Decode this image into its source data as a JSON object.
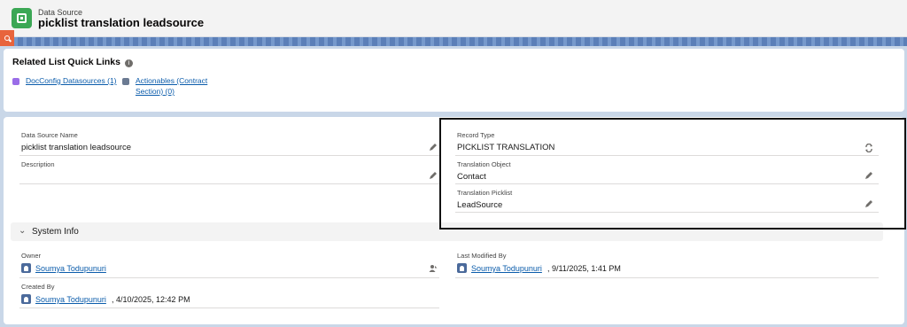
{
  "header": {
    "object_label": "Data Source",
    "record_title": "picklist translation leadsource"
  },
  "related_list_quick_links": {
    "title": "Related List Quick Links",
    "links": [
      {
        "label": "DocConfig Datasources (1)",
        "icon": "docconfig-icon",
        "icon_color": "#9a6de8"
      },
      {
        "label_line1": "Actionables (Contract",
        "label_line2": "Section) (0)",
        "icon": "actionables-icon",
        "icon_color": "#6b7a92"
      }
    ]
  },
  "details": {
    "data_source_name": {
      "label": "Data Source Name",
      "value": "picklist translation leadsource"
    },
    "description": {
      "label": "Description",
      "value": ""
    },
    "record_type": {
      "label": "Record Type",
      "value": "PICKLIST TRANSLATION"
    },
    "translation_object": {
      "label": "Translation Object",
      "value": "Contact"
    },
    "translation_picklist": {
      "label": "Translation Picklist",
      "value": "LeadSource"
    }
  },
  "system_info": {
    "title": "System Info",
    "owner": {
      "label": "Owner",
      "user": "Soumya Todupunuri"
    },
    "created_by": {
      "label": "Created By",
      "user": "Soumya Todupunuri",
      "date": ", 4/10/2025, 12:42 PM"
    },
    "last_modified_by": {
      "label": "Last Modified By",
      "user": "Soumya Todupunuri",
      "date": ", 9/11/2025, 1:41 PM"
    }
  },
  "colors": {
    "object_icon": "#3ba755",
    "link": "#0b5cab",
    "utility_tab": "#e8643c",
    "band": "#5b7fb8"
  }
}
